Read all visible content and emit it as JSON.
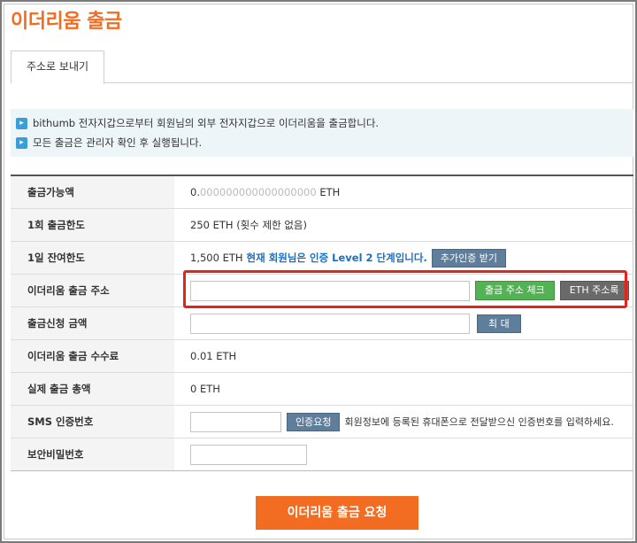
{
  "page": {
    "title": "이더리움 출금"
  },
  "tabs": [
    {
      "label": "주소로 보내기"
    }
  ],
  "notices": [
    {
      "icon": "arrow-right-icon",
      "text": "bithumb 전자지갑으로부터 회원님의 외부 전자지갑으로 이더리움을 출금합니다."
    },
    {
      "icon": "arrow-right-icon",
      "text": "모든 출금은 관리자 확인 후 실행됩니다."
    }
  ],
  "form": {
    "available": {
      "label": "출금가능액",
      "value_prefix": "0.",
      "value_muted": "000000000000000000",
      "unit": " ETH"
    },
    "single_limit": {
      "label": "1회 출금한도",
      "value": "250 ETH (횟수 제한 없음)"
    },
    "daily_limit": {
      "label": "1일 잔여한도",
      "value": "1,500 ETH",
      "level_notice": "현재 회원님은 인증 Level 2 단계입니다.",
      "button": "추가인증 받기"
    },
    "address": {
      "label": "이더리움 출금 주소",
      "value": "",
      "check_button": "출금 주소 체크",
      "book_button": "ETH 주소록"
    },
    "amount": {
      "label": "출금신청 금액",
      "value": "",
      "max_button": "최 대"
    },
    "fee": {
      "label": "이더리움 출금 수수료",
      "value": "0.01 ETH"
    },
    "total": {
      "label": "실제 출금 총액",
      "value": "0 ETH"
    },
    "sms": {
      "label": "SMS 인증번호",
      "value": "",
      "button": "인증요청",
      "hint": "회원정보에 등록된 휴대폰으로 전달받으신 인증번호를 입력하세요."
    },
    "password": {
      "label": "보안비밀번호",
      "value": ""
    }
  },
  "submit": {
    "label": "이더리움 출금 요청"
  },
  "colors": {
    "accent": "#f26c21",
    "highlight": "#e1251b",
    "green": "#53b253",
    "slate": "#5e7e9b",
    "link": "#1d6fbf"
  }
}
